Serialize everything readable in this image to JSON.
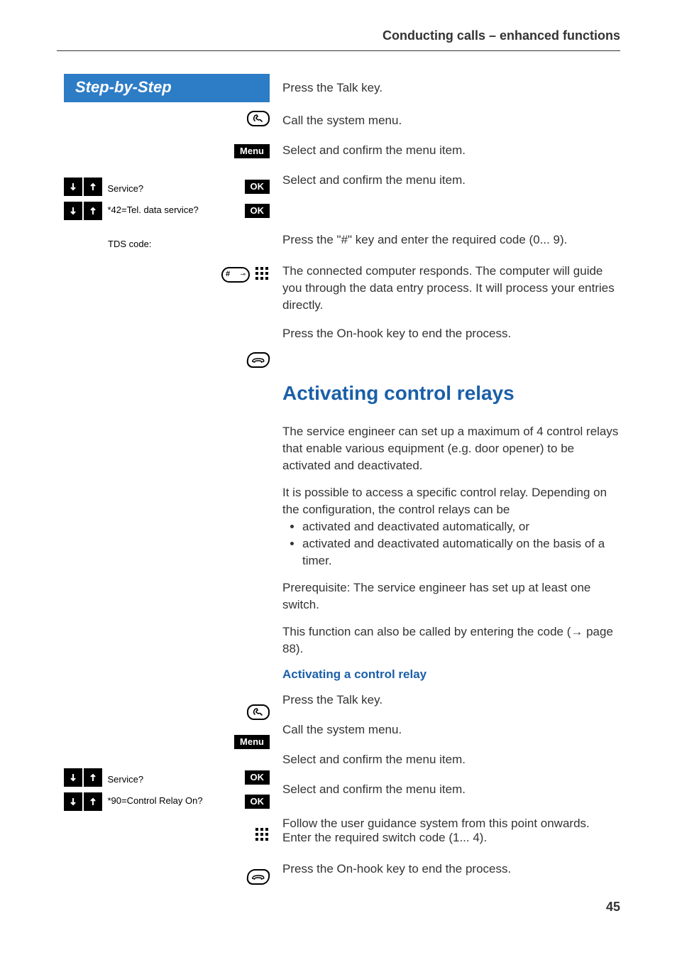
{
  "header": {
    "section_title": "Conducting calls – enhanced functions"
  },
  "sidebar": {
    "step_header": "Step-by-Step",
    "menu_btn": "Menu",
    "ok_btn": "OK",
    "items": {
      "service": "Service?",
      "tel_data": "*42=Tel. data service?",
      "tds_code": "TDS code:",
      "control_relay": "*90=Control Relay On?"
    }
  },
  "body": {
    "press_talk": "Press the Talk key.",
    "call_menu": "Call the system menu.",
    "select_confirm": "Select and confirm the menu item.",
    "press_hash": "Press the \"#\" key and enter the required code (0... 9).",
    "computer_responds": "The connected computer responds. The computer will guide you through the data entry process. It will process your entries directly.",
    "press_onhook": "Press the On-hook key to end the process.",
    "heading": "Activating control relays",
    "para1": "The service engineer can set up a maximum of 4 control relays that enable various equipment (e.g. door opener) to be activated and deactivated.",
    "para2_intro": "It is possible to access a specific control relay. Depending on the configuration, the control relays can be",
    "bullet1": "activated and deactivated automatically, or",
    "bullet2": "activated and deactivated automatically on the basis of a timer.",
    "prereq": "Prerequisite: The service engineer has set up at least one switch.",
    "code_call_pre": "This function can also be called by entering the code (",
    "code_call_arrow": "→",
    "code_call_page": " page 88).",
    "sub_heading": "Activating a control relay",
    "follow_guidance": "Follow the user guidance system from this point onwards. Enter the required switch code (1... 4)."
  },
  "page_number": "45"
}
